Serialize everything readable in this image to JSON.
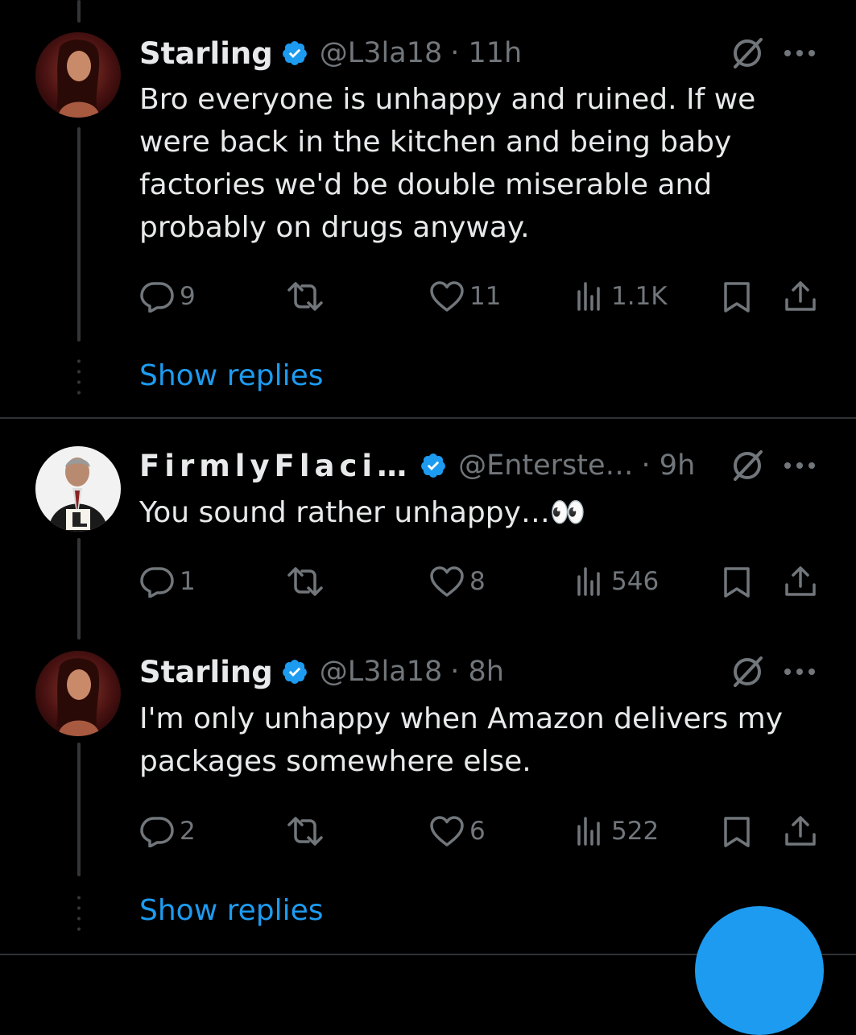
{
  "tweets": [
    {
      "name": "Starling",
      "handle": "@L3la18",
      "time": "· 11h",
      "text": "Bro everyone is unhappy and ruined. If we were back in the kitchen and being baby factories we'd be double miserable and probably on drugs anyway.",
      "replies": "9",
      "retweets": "",
      "likes": "11",
      "views": "1.1K",
      "show_replies": "Show replies"
    },
    {
      "name": "FirmlyFlaci…",
      "handle": "@Enterste…",
      "time": "· 9h",
      "text": "You sound rather unhappy…👀",
      "replies": "1",
      "retweets": "",
      "likes": "8",
      "views": "546"
    },
    {
      "name": "Starling",
      "handle": "@L3la18",
      "time": "· 8h",
      "text": "I'm only unhappy when Amazon delivers my packages somewhere else.",
      "replies": "2",
      "retweets": "",
      "likes": "6",
      "views": "522",
      "show_replies": "Show replies"
    }
  ],
  "icons": {
    "verified": "verified-badge-icon",
    "grok": "grok-icon",
    "more": "more-icon",
    "reply": "reply-icon",
    "retweet": "retweet-icon",
    "like": "like-icon",
    "views": "views-icon",
    "bookmark": "bookmark-icon",
    "share": "share-icon"
  },
  "colors": {
    "background": "#000000",
    "text": "#e7e9ea",
    "muted": "#71767b",
    "accent": "#1d9bf0",
    "divider": "#2f3336"
  }
}
